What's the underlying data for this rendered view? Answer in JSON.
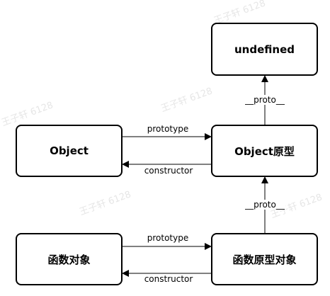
{
  "nodes": {
    "undefined": "undefined",
    "object_prototype": "Object原型",
    "object": "Object",
    "function_object": "函数对象",
    "function_prototype": "函数原型对象"
  },
  "edges": {
    "object_prototype_label": "prototype",
    "object_constructor_label": "constructor",
    "function_prototype_label": "prototype",
    "function_constructor_label": "constructor",
    "proto_top_label": "__proto__",
    "proto_bottom_label": "__proto__"
  },
  "watermark": "王子轩 6128",
  "colors": {
    "stroke": "#000000",
    "background": "#ffffff",
    "watermark": "#e6e6e6"
  }
}
